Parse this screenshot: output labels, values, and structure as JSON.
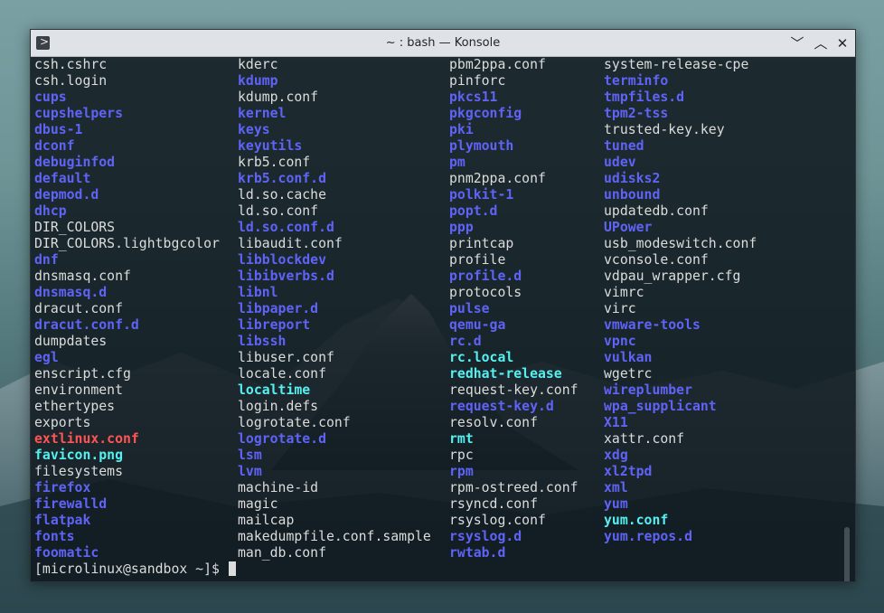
{
  "window": {
    "title": "~ : bash — Konsole",
    "app_icon": ">",
    "buttons": {
      "minimize": "﹀",
      "maximize": "︿",
      "close": "✕"
    }
  },
  "colors": {
    "file": "#dcdcdc",
    "directory": "#5f63f6",
    "symlink": "#55f0f0",
    "broken_symlink": "#ff5454"
  },
  "listing": {
    "columns": [
      {
        "entries": [
          {
            "name": "csh.cshrc",
            "type": "file"
          },
          {
            "name": "csh.login",
            "type": "file"
          },
          {
            "name": "cups",
            "type": "dir"
          },
          {
            "name": "cupshelpers",
            "type": "dir"
          },
          {
            "name": "dbus-1",
            "type": "dir"
          },
          {
            "name": "dconf",
            "type": "dir"
          },
          {
            "name": "debuginfod",
            "type": "dir"
          },
          {
            "name": "default",
            "type": "dir"
          },
          {
            "name": "depmod.d",
            "type": "dir"
          },
          {
            "name": "dhcp",
            "type": "dir"
          },
          {
            "name": "DIR_COLORS",
            "type": "file"
          },
          {
            "name": "DIR_COLORS.lightbgcolor",
            "type": "file"
          },
          {
            "name": "dnf",
            "type": "dir"
          },
          {
            "name": "dnsmasq.conf",
            "type": "file"
          },
          {
            "name": "dnsmasq.d",
            "type": "dir"
          },
          {
            "name": "dracut.conf",
            "type": "file"
          },
          {
            "name": "dracut.conf.d",
            "type": "dir"
          },
          {
            "name": "dumpdates",
            "type": "file"
          },
          {
            "name": "egl",
            "type": "dir"
          },
          {
            "name": "enscript.cfg",
            "type": "file"
          },
          {
            "name": "environment",
            "type": "file"
          },
          {
            "name": "ethertypes",
            "type": "file"
          },
          {
            "name": "exports",
            "type": "file"
          },
          {
            "name": "extlinux.conf",
            "type": "broken"
          },
          {
            "name": "favicon.png",
            "type": "link"
          },
          {
            "name": "filesystems",
            "type": "file"
          },
          {
            "name": "firefox",
            "type": "dir"
          },
          {
            "name": "firewalld",
            "type": "dir"
          },
          {
            "name": "flatpak",
            "type": "dir"
          },
          {
            "name": "fonts",
            "type": "dir"
          },
          {
            "name": "foomatic",
            "type": "dir"
          }
        ]
      },
      {
        "entries": [
          {
            "name": "kderc",
            "type": "file"
          },
          {
            "name": "kdump",
            "type": "dir"
          },
          {
            "name": "kdump.conf",
            "type": "file"
          },
          {
            "name": "kernel",
            "type": "dir"
          },
          {
            "name": "keys",
            "type": "dir"
          },
          {
            "name": "keyutils",
            "type": "dir"
          },
          {
            "name": "krb5.conf",
            "type": "file"
          },
          {
            "name": "krb5.conf.d",
            "type": "dir"
          },
          {
            "name": "ld.so.cache",
            "type": "file"
          },
          {
            "name": "ld.so.conf",
            "type": "file"
          },
          {
            "name": "ld.so.conf.d",
            "type": "dir"
          },
          {
            "name": "libaudit.conf",
            "type": "file"
          },
          {
            "name": "libblockdev",
            "type": "dir"
          },
          {
            "name": "libibverbs.d",
            "type": "dir"
          },
          {
            "name": "libnl",
            "type": "dir"
          },
          {
            "name": "libpaper.d",
            "type": "dir"
          },
          {
            "name": "libreport",
            "type": "dir"
          },
          {
            "name": "libssh",
            "type": "dir"
          },
          {
            "name": "libuser.conf",
            "type": "file"
          },
          {
            "name": "locale.conf",
            "type": "file"
          },
          {
            "name": "localtime",
            "type": "link"
          },
          {
            "name": "login.defs",
            "type": "file"
          },
          {
            "name": "logrotate.conf",
            "type": "file"
          },
          {
            "name": "logrotate.d",
            "type": "dir"
          },
          {
            "name": "lsm",
            "type": "dir"
          },
          {
            "name": "lvm",
            "type": "dir"
          },
          {
            "name": "machine-id",
            "type": "file"
          },
          {
            "name": "magic",
            "type": "file"
          },
          {
            "name": "mailcap",
            "type": "file"
          },
          {
            "name": "makedumpfile.conf.sample",
            "type": "file"
          },
          {
            "name": "man_db.conf",
            "type": "file"
          }
        ]
      },
      {
        "entries": [
          {
            "name": "pbm2ppa.conf",
            "type": "file"
          },
          {
            "name": "pinforc",
            "type": "file"
          },
          {
            "name": "pkcs11",
            "type": "dir"
          },
          {
            "name": "pkgconfig",
            "type": "dir"
          },
          {
            "name": "pki",
            "type": "dir"
          },
          {
            "name": "plymouth",
            "type": "dir"
          },
          {
            "name": "pm",
            "type": "dir"
          },
          {
            "name": "pnm2ppa.conf",
            "type": "file"
          },
          {
            "name": "polkit-1",
            "type": "dir"
          },
          {
            "name": "popt.d",
            "type": "dir"
          },
          {
            "name": "ppp",
            "type": "dir"
          },
          {
            "name": "printcap",
            "type": "file"
          },
          {
            "name": "profile",
            "type": "file"
          },
          {
            "name": "profile.d",
            "type": "dir"
          },
          {
            "name": "protocols",
            "type": "file"
          },
          {
            "name": "pulse",
            "type": "dir"
          },
          {
            "name": "qemu-ga",
            "type": "dir"
          },
          {
            "name": "rc.d",
            "type": "dir"
          },
          {
            "name": "rc.local",
            "type": "link"
          },
          {
            "name": "redhat-release",
            "type": "link"
          },
          {
            "name": "request-key.conf",
            "type": "file"
          },
          {
            "name": "request-key.d",
            "type": "dir"
          },
          {
            "name": "resolv.conf",
            "type": "file"
          },
          {
            "name": "rmt",
            "type": "link"
          },
          {
            "name": "rpc",
            "type": "file"
          },
          {
            "name": "rpm",
            "type": "dir"
          },
          {
            "name": "rpm-ostreed.conf",
            "type": "file"
          },
          {
            "name": "rsyncd.conf",
            "type": "file"
          },
          {
            "name": "rsyslog.conf",
            "type": "file"
          },
          {
            "name": "rsyslog.d",
            "type": "dir"
          },
          {
            "name": "rwtab.d",
            "type": "dir"
          }
        ]
      },
      {
        "entries": [
          {
            "name": "system-release-cpe",
            "type": "file"
          },
          {
            "name": "terminfo",
            "type": "dir"
          },
          {
            "name": "tmpfiles.d",
            "type": "dir"
          },
          {
            "name": "tpm2-tss",
            "type": "dir"
          },
          {
            "name": "trusted-key.key",
            "type": "file"
          },
          {
            "name": "tuned",
            "type": "dir"
          },
          {
            "name": "udev",
            "type": "dir"
          },
          {
            "name": "udisks2",
            "type": "dir"
          },
          {
            "name": "unbound",
            "type": "dir"
          },
          {
            "name": "updatedb.conf",
            "type": "file"
          },
          {
            "name": "UPower",
            "type": "dir"
          },
          {
            "name": "usb_modeswitch.conf",
            "type": "file"
          },
          {
            "name": "vconsole.conf",
            "type": "file"
          },
          {
            "name": "vdpau_wrapper.cfg",
            "type": "file"
          },
          {
            "name": "vimrc",
            "type": "file"
          },
          {
            "name": "virc",
            "type": "file"
          },
          {
            "name": "vmware-tools",
            "type": "dir"
          },
          {
            "name": "vpnc",
            "type": "dir"
          },
          {
            "name": "vulkan",
            "type": "dir"
          },
          {
            "name": "wgetrc",
            "type": "file"
          },
          {
            "name": "wireplumber",
            "type": "dir"
          },
          {
            "name": "wpa_supplicant",
            "type": "dir"
          },
          {
            "name": "X11",
            "type": "dir"
          },
          {
            "name": "xattr.conf",
            "type": "file"
          },
          {
            "name": "xdg",
            "type": "dir"
          },
          {
            "name": "xl2tpd",
            "type": "dir"
          },
          {
            "name": "xml",
            "type": "dir"
          },
          {
            "name": "yum",
            "type": "dir"
          },
          {
            "name": "yum.conf",
            "type": "link"
          },
          {
            "name": "yum.repos.d",
            "type": "dir"
          }
        ]
      }
    ]
  },
  "prompt": {
    "text": "[microlinux@sandbox ~]$ "
  }
}
